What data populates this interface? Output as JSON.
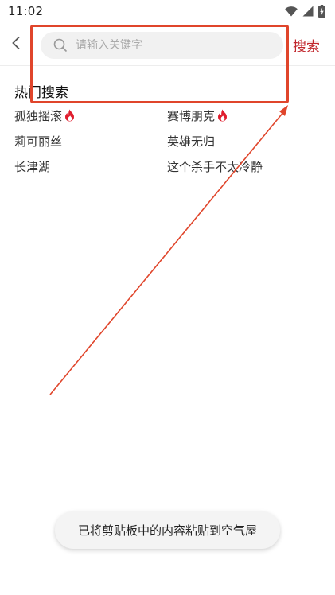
{
  "status_bar": {
    "time": "11:02",
    "icons": [
      "wifi-icon",
      "signal-icon",
      "battery-charging-icon"
    ]
  },
  "header": {
    "back_icon": "chevron-left-icon",
    "search_icon": "search-icon",
    "search_placeholder": "请输入关键字",
    "search_value": "",
    "search_button_label": "搜索",
    "accent_color": "#c1272d"
  },
  "hot_search": {
    "title": "热门搜索",
    "items": [
      {
        "label": "孤独摇滚",
        "hot": true
      },
      {
        "label": "赛博朋克",
        "hot": true
      },
      {
        "label": "莉可丽丝",
        "hot": false
      },
      {
        "label": "英雄无归",
        "hot": false
      },
      {
        "label": "长津湖",
        "hot": false
      },
      {
        "label": "这个杀手不太冷静",
        "hot": false
      }
    ]
  },
  "toast": {
    "message": "已将剪贴板中的内容粘贴到空气屋"
  },
  "annotation": {
    "color": "#e0452b"
  }
}
